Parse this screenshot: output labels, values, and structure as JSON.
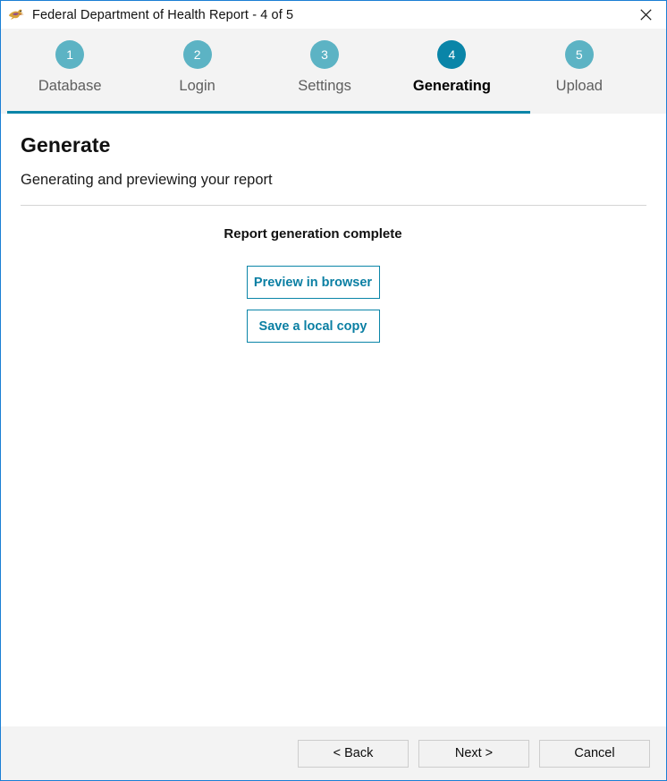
{
  "window": {
    "title": "Federal Department of Health Report - 4 of 5",
    "app_icon": "hummingbird-icon",
    "close_icon": "close-icon",
    "border_color": "#1b7fd4"
  },
  "stepper": {
    "active_index": 3,
    "active_color": "#0a85a8",
    "inactive_color": "#5cb3c4",
    "steps": [
      {
        "number": "1",
        "label": "Database"
      },
      {
        "number": "2",
        "label": "Login"
      },
      {
        "number": "3",
        "label": "Settings"
      },
      {
        "number": "4",
        "label": "Generating"
      },
      {
        "number": "5",
        "label": "Upload"
      }
    ]
  },
  "page": {
    "title": "Generate",
    "subtitle": "Generating and previewing your report",
    "status": "Report generation complete",
    "actions": [
      {
        "label": "Preview in browser"
      },
      {
        "label": "Save a local copy"
      }
    ]
  },
  "footer": {
    "back_label": "< Back",
    "next_label": "Next >",
    "cancel_label": "Cancel"
  }
}
